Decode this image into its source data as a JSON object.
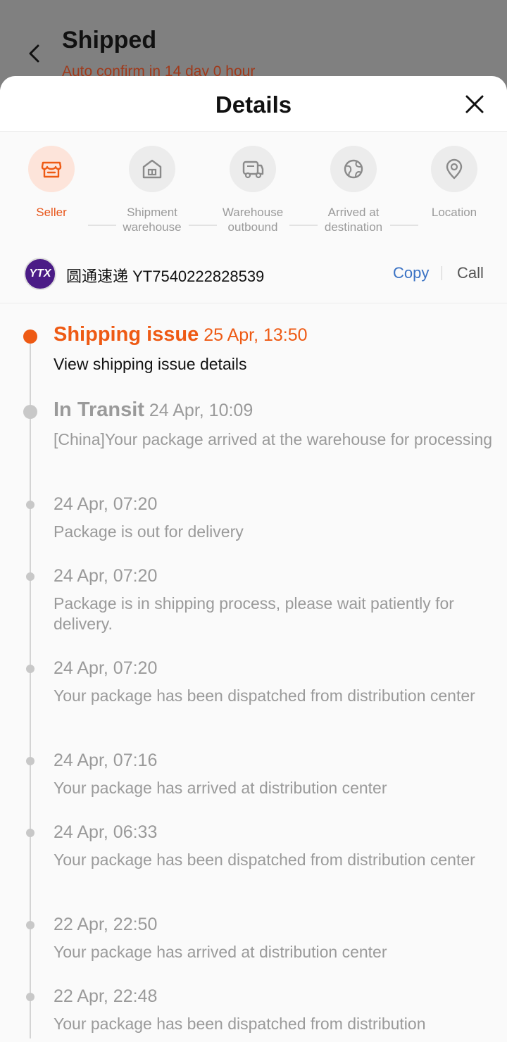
{
  "background": {
    "title": "Shipped",
    "subtitle": "Auto confirm in 14 day 0 hour"
  },
  "sheet": {
    "title": "Details"
  },
  "steps": [
    {
      "label": "Seller",
      "icon": "store-icon",
      "active": true
    },
    {
      "label": "Shipment warehouse",
      "icon": "warehouse-icon",
      "active": false
    },
    {
      "label": "Warehouse outbound",
      "icon": "truck-icon",
      "active": false
    },
    {
      "label": "Arrived at destination",
      "icon": "globe-icon",
      "active": false
    },
    {
      "label": "Location",
      "icon": "location-pin-icon",
      "active": false
    }
  ],
  "carrier": {
    "logo_text": "YTX",
    "name_tracking": "圆通速递 YT7540222828539",
    "copy_label": "Copy",
    "call_label": "Call"
  },
  "timeline": [
    {
      "status": "Shipping issue",
      "time": "25 Apr, 13:50",
      "text": "View shipping issue details"
    },
    {
      "status": "In Transit",
      "time": "24 Apr, 10:09",
      "text": "[China]Your package arrived at the warehouse for processing"
    },
    {
      "status": "",
      "time": "24 Apr, 07:20",
      "text": "Package is out for delivery"
    },
    {
      "status": "",
      "time": "24 Apr, 07:20",
      "text": "Package is in shipping process, please wait patiently for delivery."
    },
    {
      "status": "",
      "time": "24 Apr, 07:20",
      "text": "Your package has been dispatched from distribution center"
    },
    {
      "status": "",
      "time": "24 Apr, 07:16",
      "text": "Your package has arrived at distribution center"
    },
    {
      "status": "",
      "time": "24 Apr, 06:33",
      "text": "Your package has been dispatched from distribution center"
    },
    {
      "status": "",
      "time": "22 Apr, 22:50",
      "text": "Your package has arrived at distribution center"
    },
    {
      "status": "",
      "time": "22 Apr, 22:48",
      "text": "Your package has been dispatched from distribution"
    }
  ],
  "colors": {
    "accent": "#ee5a14",
    "link": "#3a72c4",
    "muted": "#9a9a9a"
  }
}
